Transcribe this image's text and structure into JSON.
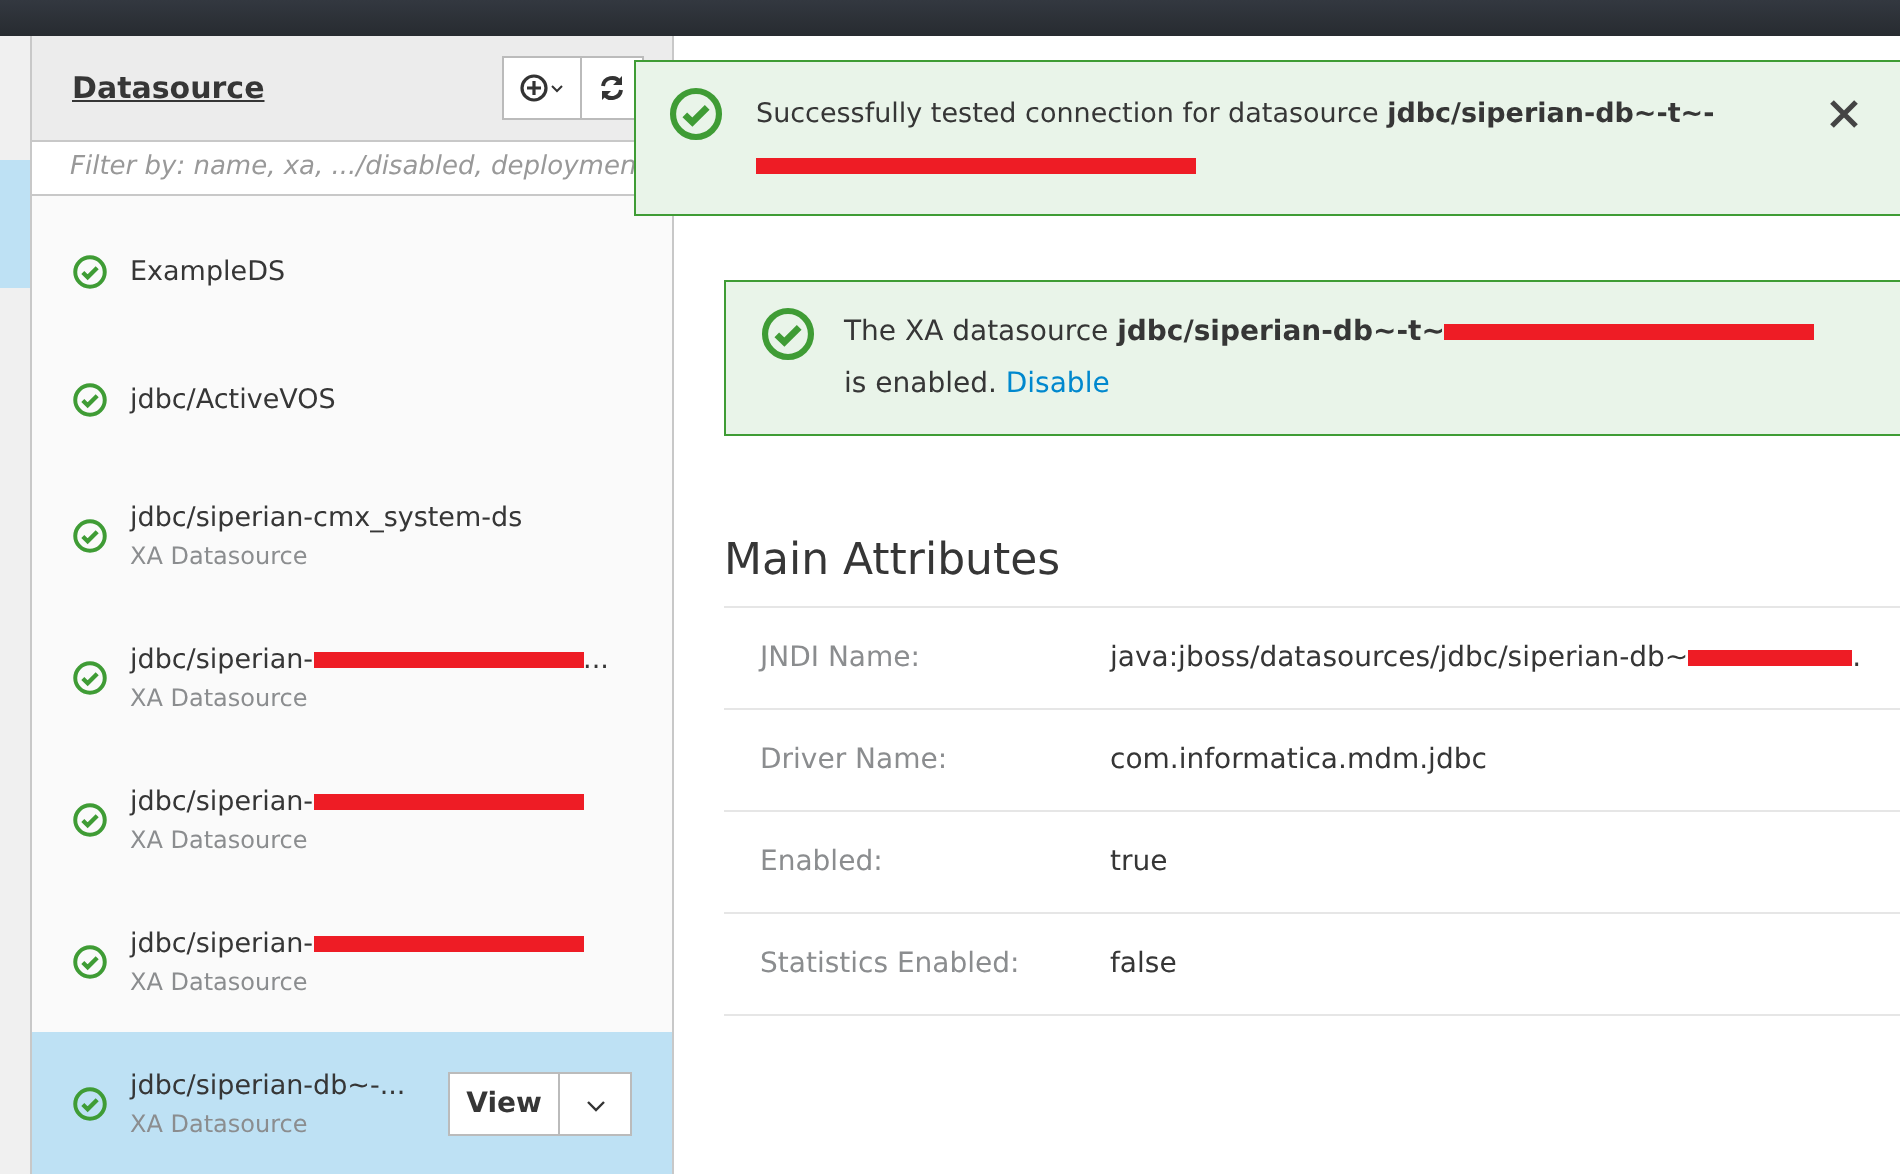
{
  "sidebar": {
    "title": "Datasource",
    "filter": {
      "placeholder": "Filter by: name, xa, .../disabled, deploymen"
    },
    "items": [
      {
        "name": "ExampleDS",
        "selected": false
      },
      {
        "name": "jdbc/ActiveVOS",
        "selected": false
      },
      {
        "name": "jdbc/siperian-cmx_system-ds",
        "type": "XA Datasource",
        "selected": false
      },
      {
        "name": "jdbc/siperian-",
        "redacted": true,
        "name_end": "...",
        "type": "XA Datasource",
        "selected": false
      },
      {
        "name": "jdbc/siperian-",
        "redacted": true,
        "type": "XA Datasource",
        "selected": false
      },
      {
        "name": "jdbc/siperian-",
        "redacted": true,
        "type": "XA Datasource",
        "selected": false
      },
      {
        "name": "jdbc/siperian-db~-...",
        "type": "XA Datasource",
        "selected": true,
        "action": "View"
      }
    ]
  },
  "toast": {
    "text": "Successfully tested connection for datasource ",
    "name": "jdbc/siperian-db~-t~-",
    "redacted": true
  },
  "alert": {
    "text": "The XA datasource ",
    "name": "jdbc/siperian-db~-t~",
    "redacted": true,
    "suffix": "is enabled.",
    "link": "Disable"
  },
  "attributes": {
    "title": "Main Attributes",
    "rows": [
      {
        "label": "JNDI Name:",
        "value": "java:jboss/datasources/jdbc/siperian-db~",
        "redacted": true,
        "value_end": "."
      },
      {
        "label": "Driver Name:",
        "value": "com.informatica.mdm.jdbc"
      },
      {
        "label": "Enabled:",
        "value": "true"
      },
      {
        "label": "Statistics Enabled:",
        "value": "false"
      }
    ]
  }
}
